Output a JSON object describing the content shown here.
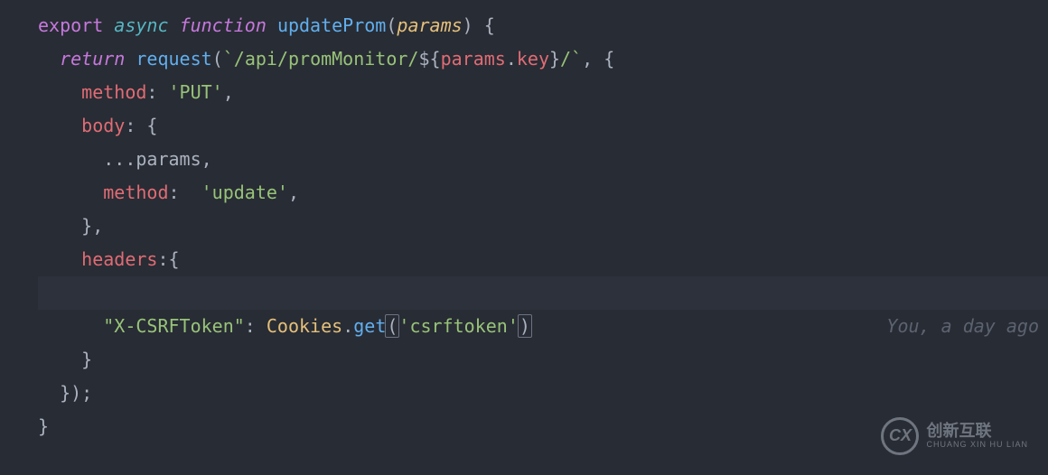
{
  "code": {
    "l1": {
      "export": "export",
      "async": "async",
      "function": "function",
      "fnName": "updateProm",
      "param": "params"
    },
    "l2": {
      "return": "return",
      "callFn": "request",
      "tmplPrefix": "`/api/promMonitor/",
      "exprObj": "params",
      "exprKey": "key",
      "tmplSuffix": "/`"
    },
    "l3": {
      "prop": "method",
      "value": "'PUT'"
    },
    "l4": {
      "prop": "body"
    },
    "l5": {
      "spread": "...",
      "param": "params"
    },
    "l6": {
      "prop": "method",
      "value": "'update'"
    },
    "l7": {},
    "l8": {
      "prop": "headers"
    },
    "l9": {
      "keyStr": "\"X-CSRFToken\"",
      "obj": "Cookies",
      "method": "get",
      "arg": "'csrftoken'"
    },
    "l10": {},
    "l11": {},
    "l12": {}
  },
  "gitlens": "You, a day ago",
  "watermark": {
    "logo": "CX",
    "main": "创新互联",
    "sub": "CHUANG XIN HU LIAN"
  }
}
